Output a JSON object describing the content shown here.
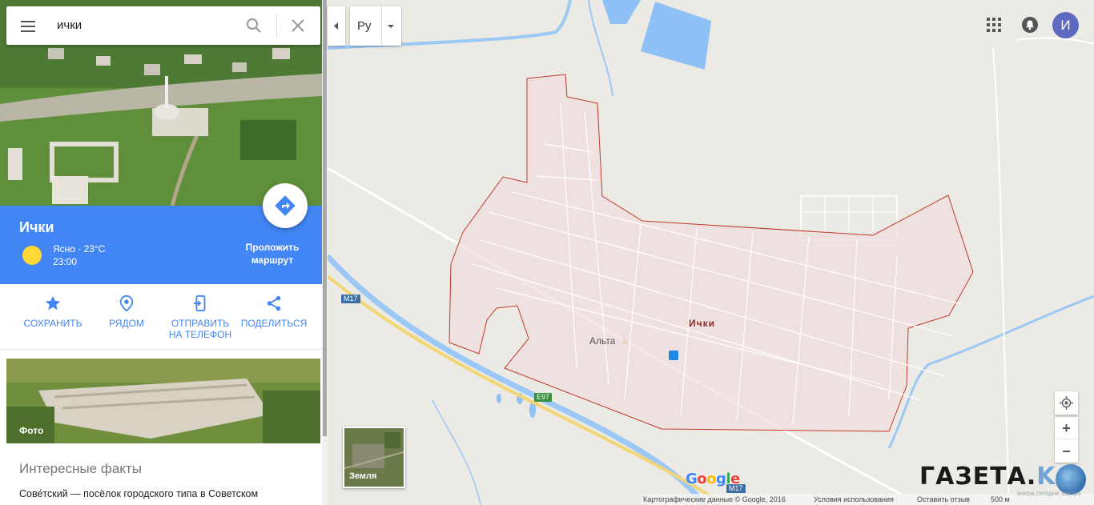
{
  "search": {
    "query": "ички"
  },
  "place": {
    "title": "Ички",
    "weather": "Ясно · 23°C",
    "time": "23:00",
    "route_label_1": "Проложить",
    "route_label_2": "маршрут"
  },
  "actions": [
    {
      "label_1": "СОХРАНИТЬ",
      "label_2": "",
      "icon": "star-icon"
    },
    {
      "label_1": "РЯДОМ",
      "label_2": "",
      "icon": "nearby-icon"
    },
    {
      "label_1": "ОТПРАВИТЬ",
      "label_2": "НА ТЕЛЕФОН",
      "icon": "send-to-phone-icon"
    },
    {
      "label_1": "ПОДЕЛИТЬСЯ",
      "label_2": "",
      "icon": "share-icon"
    }
  ],
  "photo": {
    "label": "Фото"
  },
  "facts": {
    "title": "Интересные факты",
    "text": "Сове́тский — посёлок городского типа в Советском"
  },
  "map": {
    "language": "Ру",
    "layer_label": "Земля",
    "place_label": "Ички",
    "poi_label": "Альта",
    "roads": {
      "m17_a": "M17",
      "e97": "E97",
      "m17_b": "M17"
    },
    "avatar_letter": "И",
    "colors": {
      "accent": "#4285f4",
      "boundary": "#c0392b",
      "water": "#8ec1f5"
    }
  },
  "footer": {
    "data": "Картографические данные © Google, 2016",
    "terms": "Условия использования",
    "feedback": "Оставить отзыв",
    "scale": "500 м"
  },
  "logo": {
    "google": "Google"
  },
  "watermark": {
    "main": "ГАЗЕТА.",
    "kg": "KG",
    "sub": "вчера сегодня завтра"
  }
}
